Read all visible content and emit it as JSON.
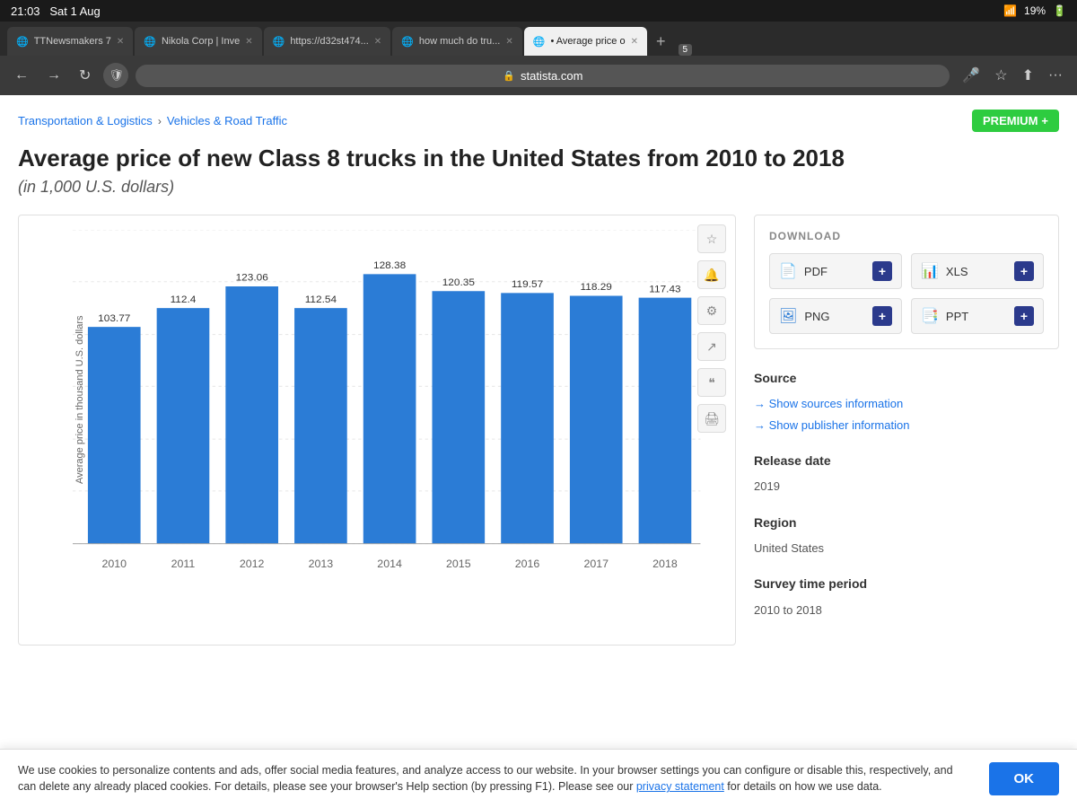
{
  "statusBar": {
    "time": "21:03",
    "date": "Sat 1 Aug",
    "wifi": "WiFi",
    "battery": "19%"
  },
  "tabs": [
    {
      "id": "tab1",
      "label": "TTNewsmakers 7",
      "active": false,
      "favicon": "🌐"
    },
    {
      "id": "tab2",
      "label": "Nikola Corp | Inve",
      "active": false,
      "favicon": "🌐"
    },
    {
      "id": "tab3",
      "label": "https://d32st474...",
      "active": false,
      "favicon": "🌐"
    },
    {
      "id": "tab4",
      "label": "how much do tru...",
      "active": false,
      "favicon": "🌐"
    },
    {
      "id": "tab5",
      "label": "• Average price o",
      "active": true,
      "favicon": "🌐"
    }
  ],
  "tabBadge": "5",
  "addressBar": {
    "url": "statista.com",
    "lock": "🔒"
  },
  "breadcrumb": {
    "part1": "Transportation & Logistics",
    "separator": "›",
    "part2": "Vehicles & Road Traffic"
  },
  "premium": {
    "label": "PREMIUM",
    "plus": "+"
  },
  "title": "Average price of new Class 8 trucks in the United States from 2010 to 2018",
  "subtitle": "(in 1,000 U.S. dollars)",
  "chart": {
    "yAxisLabel": "Average price in thousand U.S. dollars",
    "yTicks": [
      0,
      25,
      50,
      75,
      100,
      125,
      150
    ],
    "bars": [
      {
        "year": "2010",
        "value": 103.77
      },
      {
        "year": "2011",
        "value": 112.4
      },
      {
        "year": "2012",
        "value": 123.06
      },
      {
        "year": "2013",
        "value": 112.54
      },
      {
        "year": "2014",
        "value": 128.38
      },
      {
        "year": "2015",
        "value": 120.35
      },
      {
        "year": "2016",
        "value": 119.57
      },
      {
        "year": "2017",
        "value": 118.29
      },
      {
        "year": "2018",
        "value": 117.43
      }
    ],
    "maxValue": 150,
    "icons": [
      "⭐",
      "🔔",
      "⚙",
      "↗",
      "💬",
      "🖨"
    ]
  },
  "download": {
    "title": "DOWNLOAD",
    "buttons": [
      {
        "id": "pdf",
        "label": "PDF",
        "icon": "📄",
        "color": "red"
      },
      {
        "id": "xls",
        "label": "XLS",
        "icon": "📊",
        "color": "green"
      },
      {
        "id": "png",
        "label": "PNG",
        "icon": "🖼",
        "color": "blue"
      },
      {
        "id": "ppt",
        "label": "PPT",
        "icon": "📑",
        "color": "orange"
      }
    ],
    "plus": "+"
  },
  "source": {
    "title": "Source",
    "links": [
      "→ Show sources information",
      "→ Show publisher information"
    ]
  },
  "releaseDate": {
    "title": "Release date",
    "value": "2019"
  },
  "region": {
    "title": "Region",
    "value": "United States"
  },
  "surveyTimePeriod": {
    "title": "Survey time period",
    "value": "2010 to 2018"
  },
  "cookie": {
    "text": "We use cookies to personalize contents and ads, offer social media features, and analyze access to our website. In your browser settings you can configure or disable this, respectively, and can delete any already placed cookies. For details, please see your browser's Help section (by pressing F1). Please see our ",
    "linkText": "privacy statement",
    "textAfterLink": " for details on how we use data.",
    "okLabel": "OK"
  }
}
